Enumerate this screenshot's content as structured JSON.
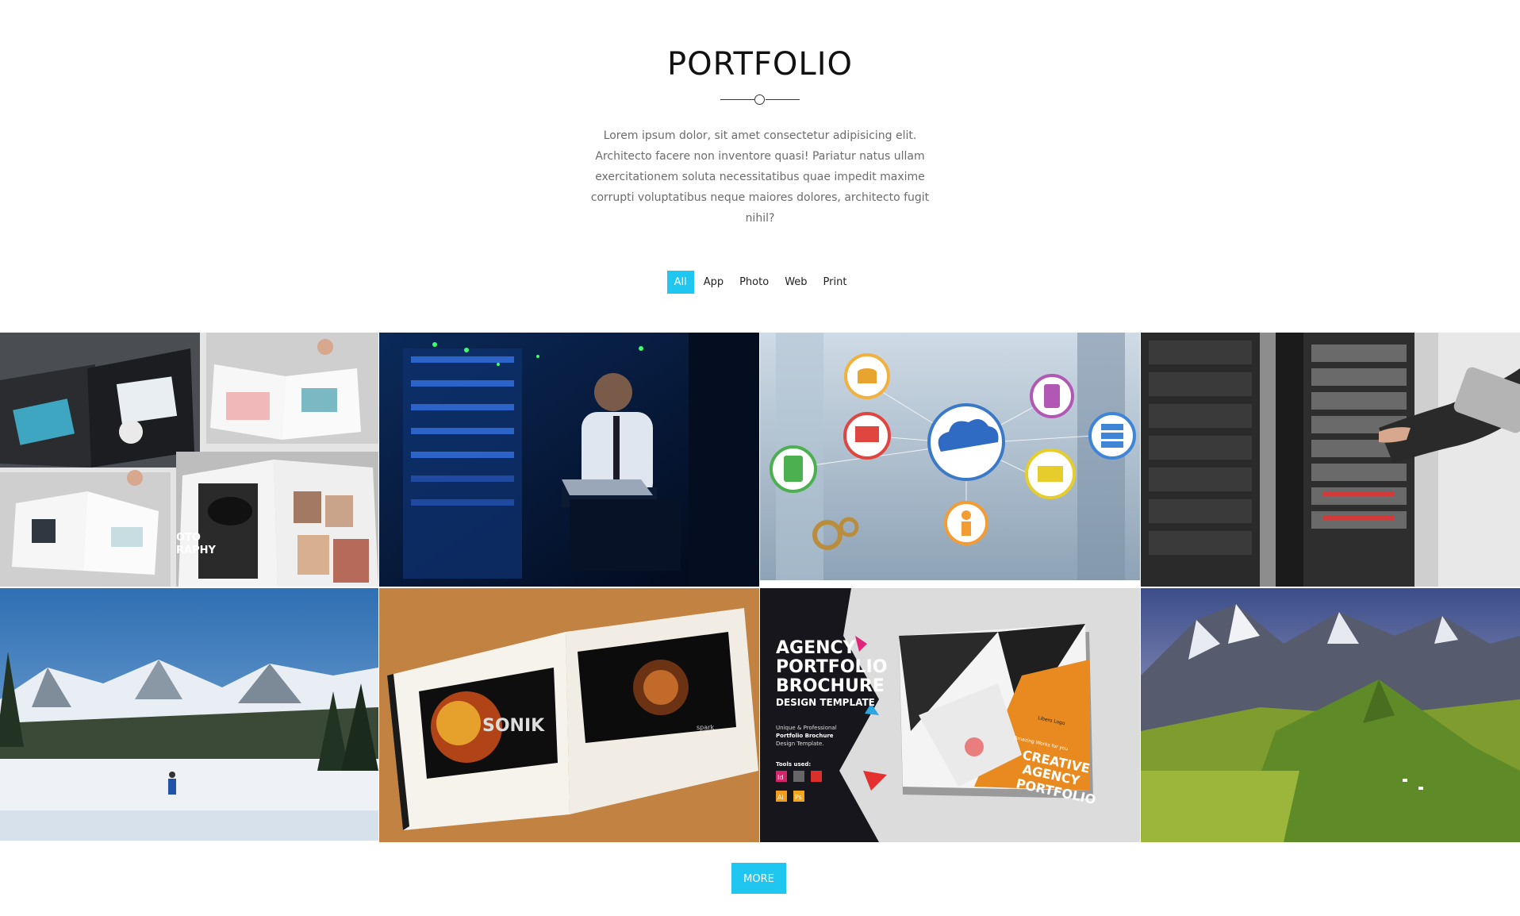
{
  "section": {
    "title": "PORTFOLIO",
    "intro": "Lorem ipsum dolor, sit amet consectetur adipisicing elit. Architecto facere non inventore quasi! Pariatur natus ullam exercitationem soluta necessitatibus quae impedit maxime corrupti voluptatibus neque maiores dolores, architecto fugit nihil?"
  },
  "filters": [
    {
      "label": "All",
      "active": true
    },
    {
      "label": "App",
      "active": false
    },
    {
      "label": "Photo",
      "active": false
    },
    {
      "label": "Web",
      "active": false
    },
    {
      "label": "Print",
      "active": false
    }
  ],
  "portfolio": {
    "items": [
      {
        "subject": "magazine brochure mockups"
      },
      {
        "subject": "engineer with laptop in server room"
      },
      {
        "subject": "cloud network icons"
      },
      {
        "subject": "hand on server rack with tablet"
      },
      {
        "subject": "snowy mountain landscape"
      },
      {
        "subject": "open photo book"
      },
      {
        "subject": "agency portfolio brochure"
      },
      {
        "subject": "alpine mountain valley"
      }
    ],
    "tile5_text": {
      "brand": "SONIK",
      "brand_small": "spark"
    },
    "tile6_text": {
      "heading": [
        "AGENCY",
        "PORTFOLIO",
        "BROCHURE"
      ],
      "subheading": "DESIGN TEMPLATE",
      "tagline": [
        "Unique & Professional",
        "Portfolio Brochure",
        "Design Template."
      ],
      "tools_label": "Tools used:",
      "tools": [
        "Id",
        "Ai",
        "Ps"
      ],
      "cover_lines": [
        "CREATIVE",
        "AGENCY",
        "PORTFOLIO"
      ],
      "cover_small": "Amazing Works for you",
      "cover_logo": "Libero Logo"
    },
    "tile0_text": {
      "word1": "OTO",
      "word2": "RAPHY"
    }
  },
  "more_button": {
    "label": "MORE"
  },
  "colors": {
    "accent": "#1ec6f0"
  }
}
